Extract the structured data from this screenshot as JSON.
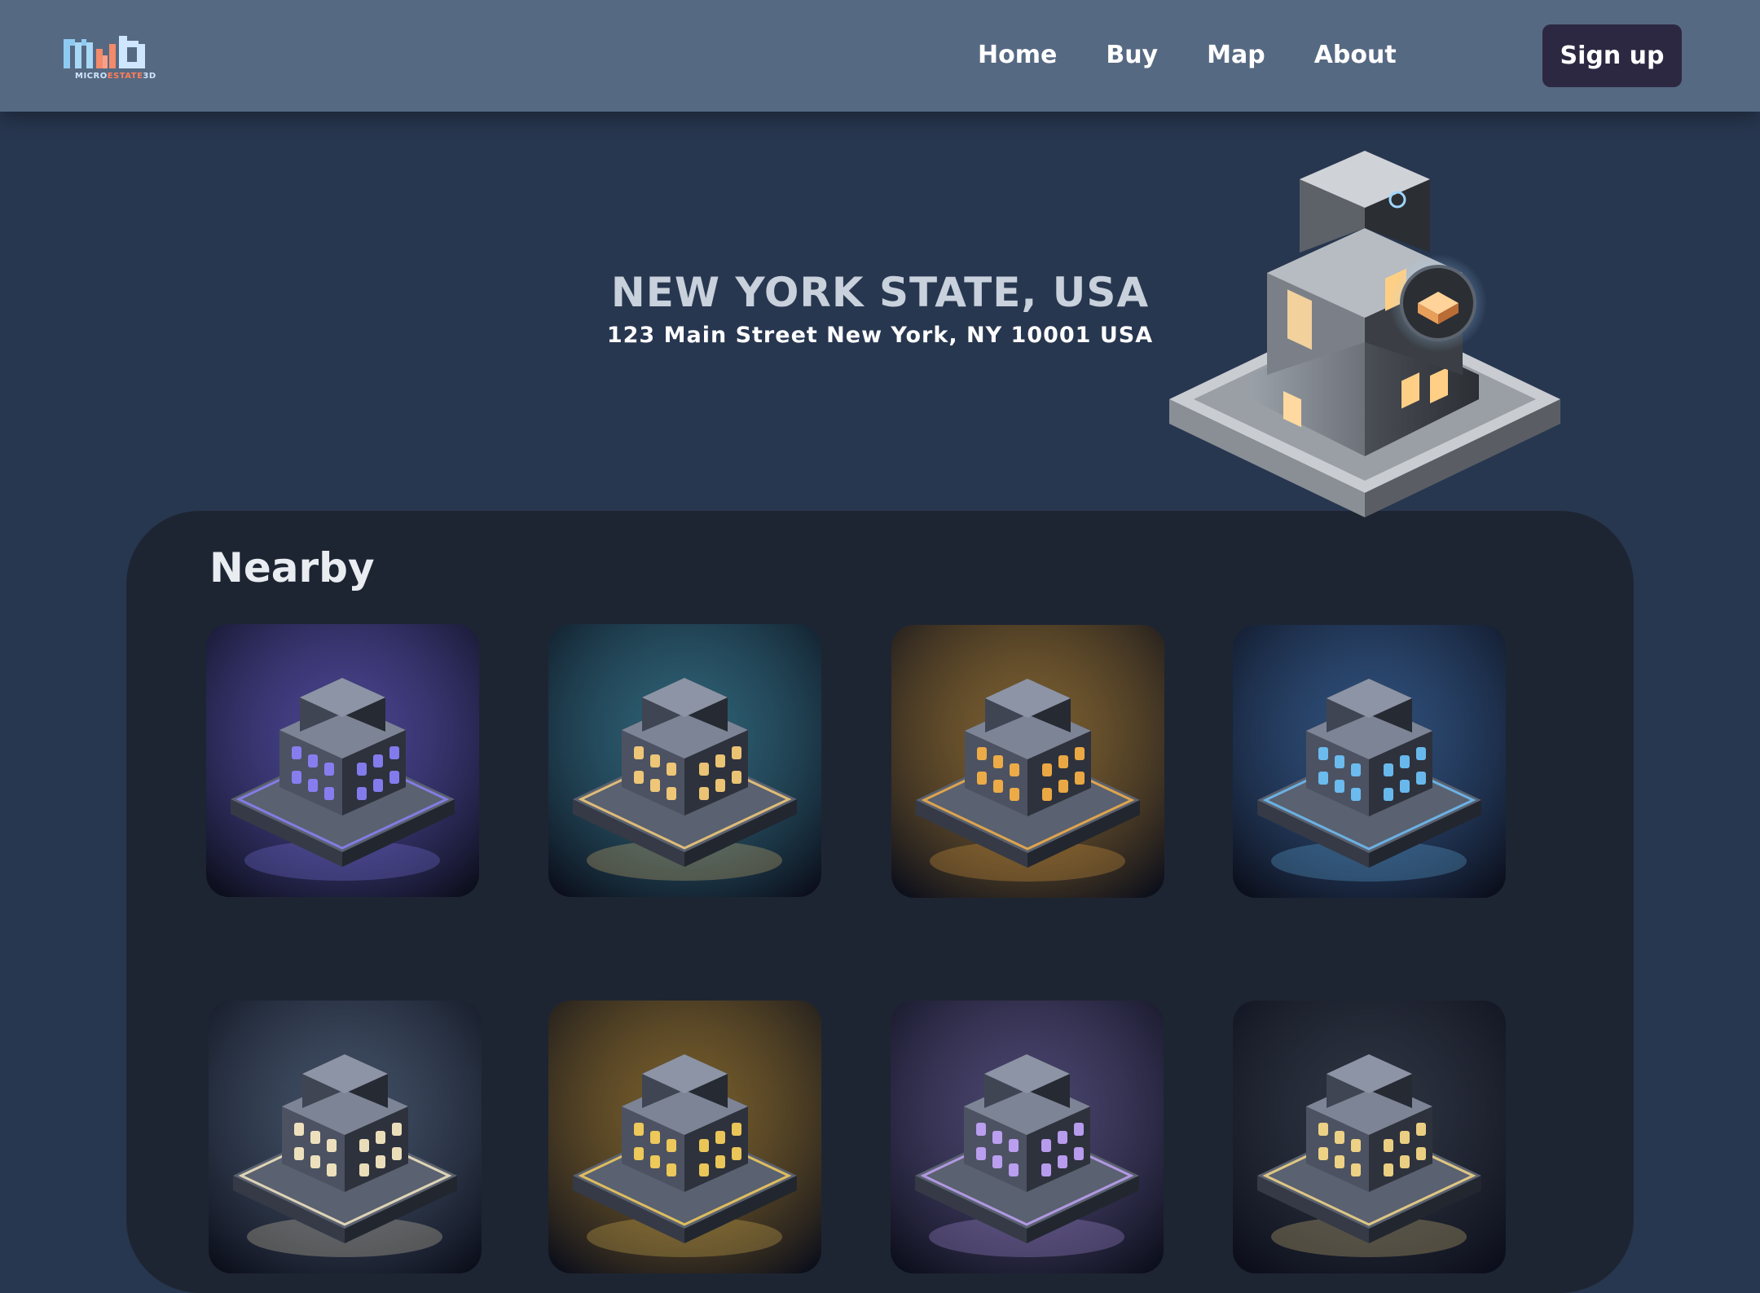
{
  "header": {
    "logo_text_a": "MICRO",
    "logo_text_b": "ESTATE",
    "logo_text_c": "3D",
    "nav": [
      {
        "label": "Home"
      },
      {
        "label": "Buy"
      },
      {
        "label": "Map"
      },
      {
        "label": "About"
      }
    ],
    "signup_label": "Sign up"
  },
  "hero": {
    "title": "NEW YORK STATE, USA",
    "address": "123 Main Street New York, NY 10001 USA"
  },
  "nearby": {
    "title": "Nearby",
    "cards": [
      {
        "theme": "#6a5cd6",
        "glow": "#8d83ff"
      },
      {
        "theme": "#3b8fa8",
        "glow": "#ffd37a"
      },
      {
        "theme": "#c08a2f",
        "glow": "#ffb545"
      },
      {
        "theme": "#3d6fb0",
        "glow": "#6fc6ff"
      },
      {
        "theme": "#5b6e8a",
        "glow": "#fff1c8"
      },
      {
        "theme": "#b88728",
        "glow": "#ffd55a"
      },
      {
        "theme": "#6c5d9c",
        "glow": "#c7a6ff"
      },
      {
        "theme": "#3a3f4d",
        "glow": "#ffe08a"
      }
    ]
  },
  "colors": {
    "header_bg": "#566982",
    "page_bg": "#283750",
    "panel_bg": "#1e2532",
    "signup_bg": "#2d2842"
  }
}
